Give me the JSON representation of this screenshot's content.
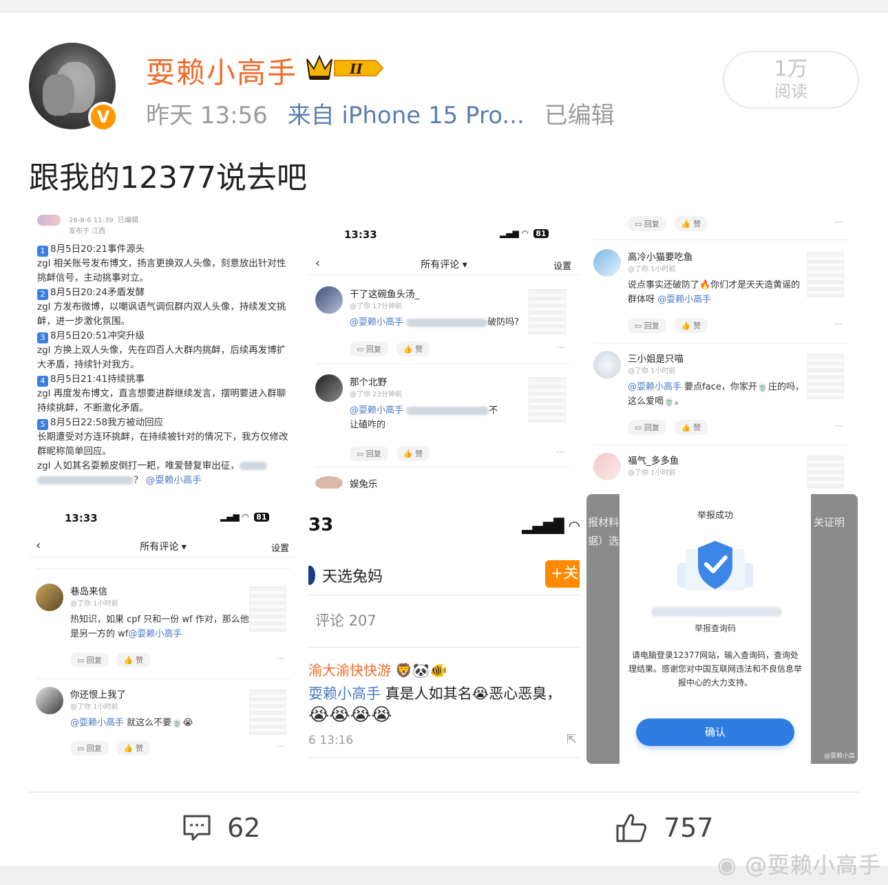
{
  "post": {
    "username": "耍赖小高手",
    "vip_badge": "II",
    "time": "昨天 13:56",
    "source": "来自 iPhone 15 Pro...",
    "edited": "已编辑",
    "reads_num": "1万",
    "reads_label": "阅读",
    "text": "跟我的12377说去吧"
  },
  "img1": {
    "date": "26-8-6 11:39",
    "edited": "已编辑",
    "location": "发布于 江西",
    "items": [
      {
        "num": "1",
        "title": "8月5日20:21事件源头",
        "body": "zgl 相关账号发布博文，扬言更换双人头像，刻意放出针对性挑衅信号，主动挑事对立。"
      },
      {
        "num": "2",
        "title": "8月5日20:24矛盾发酵",
        "body": "zgl 方发布微博，以嘲讽语气调侃群内双人头像，持续发文挑衅，进一步激化氛围。"
      },
      {
        "num": "3",
        "title": "8月5日20:51冲突升级",
        "body": "zgl 方换上双人头像，先在四百人大群内挑衅，后续再发博扩大矛盾，持续针对我方。"
      },
      {
        "num": "4",
        "title": "8月5日21:41持续挑事",
        "body": "zgl 再度发布博文，直言想要进群继续发言，摆明要进入群聊持续挑衅，不断激化矛盾。"
      },
      {
        "num": "5",
        "title": "8月5日22:58我方被动回应",
        "body": "长期遭受对方连环挑衅，在持续被针对的情况下，我方仅修改群昵称简单回应。"
      }
    ],
    "closing": "zgl 人如其名耍赖皮倒打一耙，唯爱替复审出征，",
    "closing_end": "？",
    "mention": "@耍赖小高手"
  },
  "img2": {
    "clock": "13:33",
    "battery": "81",
    "nav_title": "所有评论 ▾",
    "nav_setting": "设置",
    "comments": [
      {
        "name": "干了这碗鱼头汤_",
        "time": "@了你  17分钟前",
        "mention": "@耍赖小高手",
        "text_end": "破防吗?"
      },
      {
        "name": "那个北野",
        "time": "@了你  23分钟前",
        "mention": "@耍赖小高手",
        "text_mid": "不",
        "text_end": "让磕咋的"
      },
      {
        "name": "娱兔乐"
      }
    ],
    "reply": "回复",
    "like": "赞"
  },
  "img3": {
    "reply": "回复",
    "like": "赞",
    "comments": [
      {
        "name": "高冷小猫要吃鱼",
        "time": "@了你  1小时前",
        "text": "说点事实还破防了🔥你们才是天天造黄谣的群体呀",
        "mention": "@耍赖小高手"
      },
      {
        "name": "三小姐是只喵",
        "time": "@了你  1小时前",
        "mention": "@耍赖小高手",
        "text": "要点face，你家开🍵庄的吗，这么爱喝🍵。"
      },
      {
        "name": "福气_多多鱼",
        "time": "@了你  1小时前"
      }
    ]
  },
  "img4": {
    "clock": "13:33",
    "battery": "81",
    "nav_title": "所有评论 ▾",
    "nav_setting": "设置",
    "reply": "回复",
    "like": "赞",
    "comments": [
      {
        "name": "巷岛来信",
        "time": "@了你  1小时前",
        "text": "热知识，如果 cpf 只和一份 wf 作对，那么他是另一方的 wf",
        "mention": "@耍赖小高手"
      },
      {
        "name": "你还恨上我了",
        "time": "@了你  1小时前",
        "mention": "@耍赖小高手",
        "text": "就这么不要🍵😭"
      }
    ]
  },
  "img5": {
    "clock": "33",
    "user": "天选兔妈",
    "follow": "+关",
    "count": "评论 207",
    "commenter": "渝大渝快快游",
    "commenter_emoji": "🦁🐼🐠",
    "mention": "耍赖小高手",
    "text": "真是人如其名😭恶心恶臭，",
    "emojis": "😭😭😭😭",
    "time": "6 13:16"
  },
  "img6": {
    "left_text_1": "报材料",
    "left_text_2": "据）选",
    "right_text": "关证明",
    "title": "举报成功",
    "code_label": "举报查询码",
    "msg": "请电脑登录12377网站，输入查询码，查询处理结果。感谢您对中国互联网违法和不良信息举报中心的大力支持。",
    "confirm": "确认",
    "watermark": "@耍赖小高"
  },
  "footer": {
    "comments": "62",
    "likes": "757",
    "watermark": "@耍赖小高手"
  },
  "colors": {
    "username": "#f06a2b",
    "link": "#5b7eb0",
    "accent_blue": "#2f7de1"
  }
}
